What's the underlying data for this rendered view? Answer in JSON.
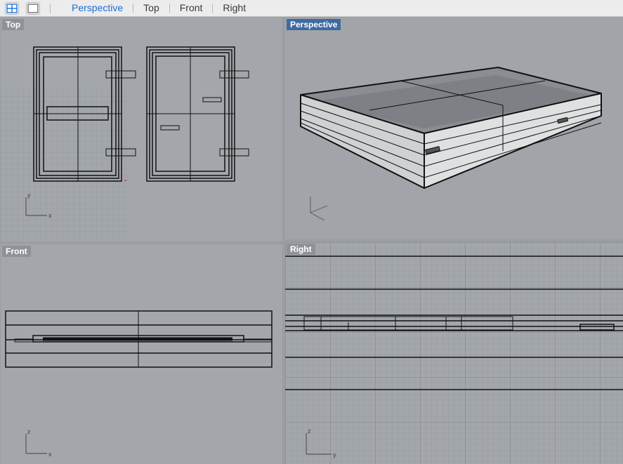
{
  "toolbar": {
    "tabs": [
      {
        "label": "Perspective",
        "active": true
      },
      {
        "label": "Top",
        "active": false
      },
      {
        "label": "Front",
        "active": false
      },
      {
        "label": "Right",
        "active": false
      }
    ],
    "icons": [
      "four-viewports-icon",
      "single-viewport-icon"
    ],
    "accent_color": "#1b6fd6"
  },
  "viewports": {
    "top": {
      "label": "Top",
      "axis_x": "x",
      "axis_y": "y"
    },
    "perspective": {
      "label": "Perspective",
      "active": true
    },
    "front": {
      "label": "Front",
      "axis_x": "x",
      "axis_y": "z"
    },
    "right": {
      "label": "Right",
      "axis_x": "y",
      "axis_y": "z"
    }
  }
}
